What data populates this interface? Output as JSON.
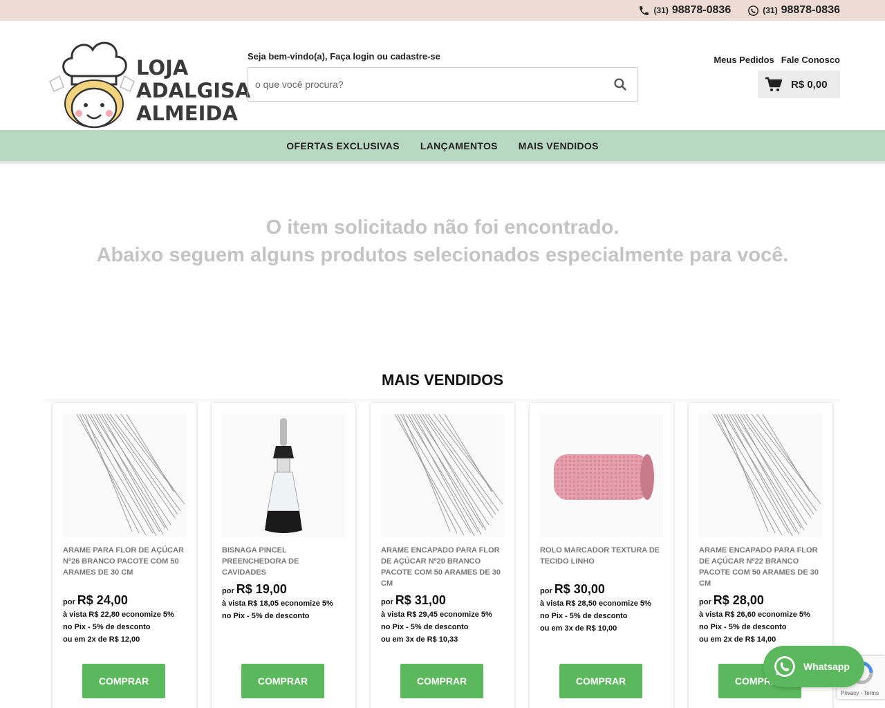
{
  "topbar": {
    "phone1": {
      "ddd": "(31)",
      "number": "98878-0836"
    },
    "phone2": {
      "ddd": "(31)",
      "number": "98878-0836"
    }
  },
  "logo": {
    "line1": "LOJA",
    "line2": "ADALGISA",
    "line3": "ALMEIDA"
  },
  "welcome": "Seja bem-vindo(a), Faça login ou cadastre-se",
  "search": {
    "placeholder": "o que você procura?"
  },
  "header_links": {
    "orders": "Meus Pedidos",
    "contact": "Fale Conosco"
  },
  "cart": {
    "total": "R$ 0,00"
  },
  "nav": {
    "items": [
      "OFERTAS EXCLUSIVAS",
      "LANÇAMENTOS",
      "MAIS VENDIDOS"
    ]
  },
  "not_found": {
    "line1": "O item solicitado não foi encontrado.",
    "line2": "Abaixo seguem alguns produtos selecionados especialmente para você."
  },
  "section_title": "MAIS VENDIDOS",
  "products": [
    {
      "name": "ARAME PARA FLOR DE AÇÚCAR Nº26 BRANCO PACOTE COM 50 ARAMES DE 30 CM",
      "por": "por",
      "price": "R$ 24,00",
      "cash": "à vista R$ 22,80 economize 5%",
      "pix": "no Pix - 5% de desconto",
      "installments": "ou em 2x de R$ 12,00",
      "buy": "COMPRAR"
    },
    {
      "name": "BISNAGA PINCEL PREENCHEDORA DE CAVIDADES",
      "por": "por",
      "price": "R$ 19,00",
      "cash": "à vista R$ 18,05 economize 5%",
      "pix": "no Pix - 5% de desconto",
      "installments": "",
      "buy": "COMPRAR"
    },
    {
      "name": "ARAME ENCAPADO PARA FLOR DE AÇÚCAR Nº20 BRANCO PACOTE COM 50 ARAMES DE 30 CM",
      "por": "por",
      "price": "R$ 31,00",
      "cash": "à vista R$ 29,45 economize 5%",
      "pix": "no Pix - 5% de desconto",
      "installments": "ou em 3x de R$ 10,33",
      "buy": "COMPRAR"
    },
    {
      "name": "ROLO MARCADOR TEXTURA DE TECIDO LINHO",
      "por": "por",
      "price": "R$ 30,00",
      "cash": "à vista R$ 28,50 economize 5%",
      "pix": "no Pix - 5% de desconto",
      "installments": "ou em 3x de R$ 10,00",
      "buy": "COMPRAR"
    },
    {
      "name": "ARAME ENCAPADO PARA FLOR DE AÇÚCAR Nº22 BRANCO PACOTE COM 50 ARAMES DE 30 CM",
      "por": "por",
      "price": "R$ 28,00",
      "cash": "à vista R$ 26,60 economize 5%",
      "pix": "no Pix - 5% de desconto",
      "installments": "ou em 2x de R$ 14,00",
      "buy": "COMPRAR"
    }
  ],
  "whatsapp": {
    "label": "Whatsapp"
  },
  "recaptcha": {
    "links": "Privacy - Terms"
  },
  "colors": {
    "topbar": "#ecdcd3",
    "nav": "#b9d8c2",
    "buy_button": "#5cb85c",
    "whatsapp": "#5cb85c",
    "notfound_text": "#c4c4c4"
  }
}
